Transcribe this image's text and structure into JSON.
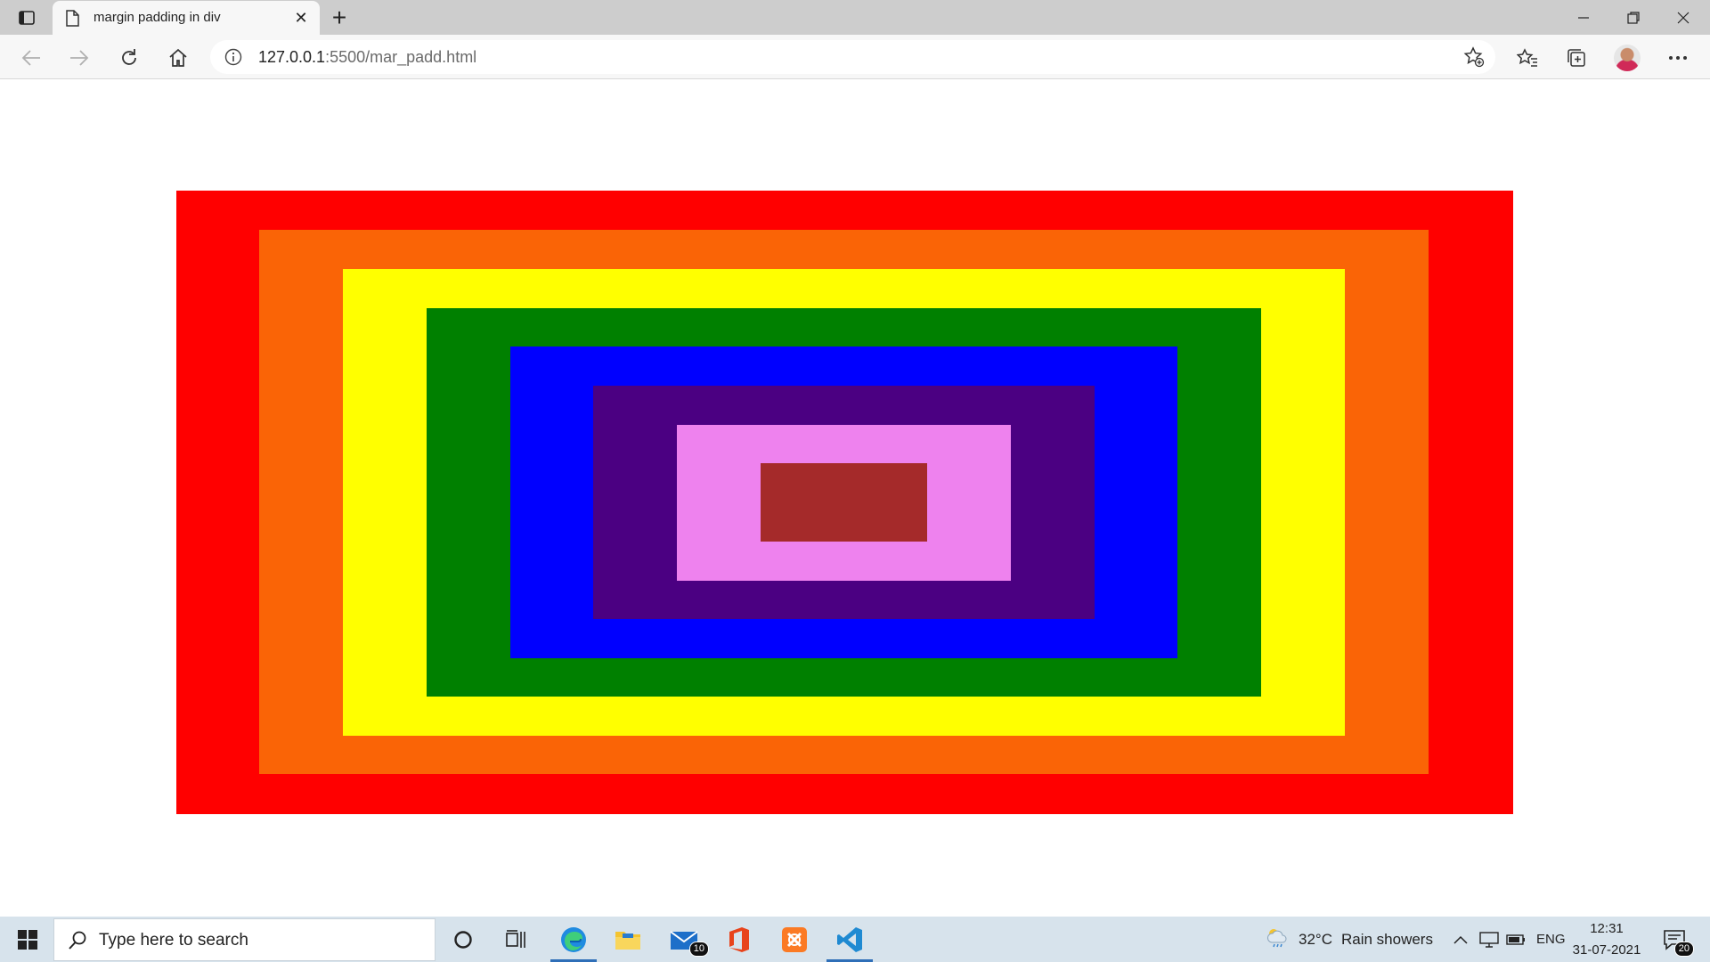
{
  "browser": {
    "tab": {
      "title": "margin padding in div"
    },
    "address": {
      "host": "127.0.0.1",
      "rest": ":5500/mar_padd.html"
    }
  },
  "page": {
    "boxes": [
      {
        "name": "box-red",
        "color": "#ff0000"
      },
      {
        "name": "box-orange",
        "color": "#fa6406"
      },
      {
        "name": "box-yellow",
        "color": "#ffff00"
      },
      {
        "name": "box-green",
        "color": "#008000"
      },
      {
        "name": "box-blue",
        "color": "#0000ff"
      },
      {
        "name": "box-indigo",
        "color": "#4b0082"
      },
      {
        "name": "box-violet",
        "color": "#ee82ee"
      },
      {
        "name": "box-brown",
        "color": "#a52a2a"
      }
    ]
  },
  "taskbar": {
    "search_placeholder": "Type here to search",
    "mail_badge": "10",
    "weather": {
      "temp": "32°C",
      "desc": "Rain showers"
    },
    "language": "ENG",
    "time": "12:31",
    "date": "31-07-2021",
    "notifications": "20"
  }
}
